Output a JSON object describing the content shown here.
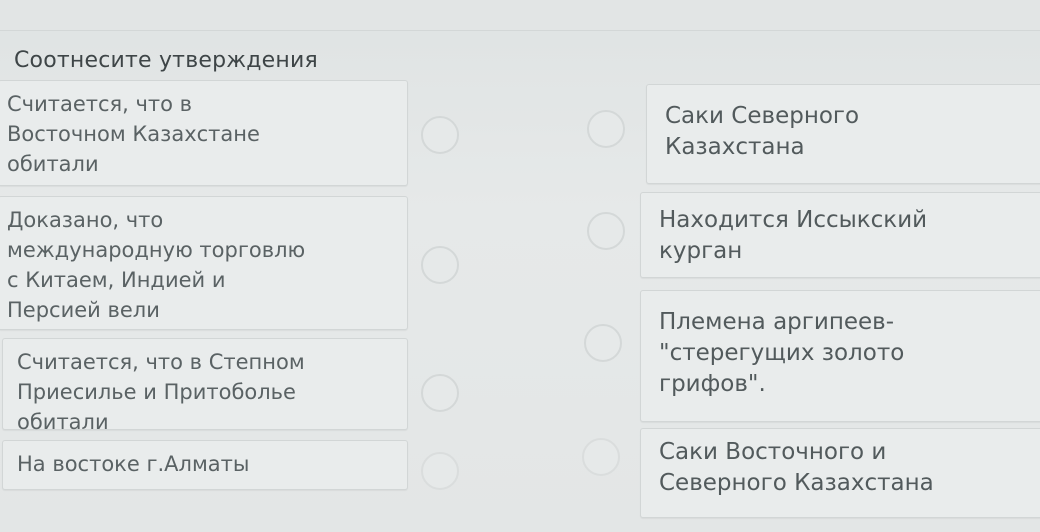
{
  "question": {
    "title": "Соотнесите утверждения"
  },
  "left_items": [
    {
      "text": "Считается, что в\nВосточном Казахстане\nобитали"
    },
    {
      "text": "Доказано, что\nмеждународную торговлю\nс Китаем, Индией и\nПерсией вели"
    },
    {
      "text": "Считается, что в Степном\nПриесилье и Притоболье\nобитали"
    },
    {
      "text": "На востоке г.Алматы"
    }
  ],
  "right_items": [
    {
      "text": "Саки Северного\nКазахстана"
    },
    {
      "text": "Находится Иссыкский\nкурган"
    },
    {
      "text": "Племена аргипеев-\n\"стерегущих золото\nгрифов\"."
    },
    {
      "text": "Саки Восточного и\nСеверного Казахстана"
    }
  ]
}
